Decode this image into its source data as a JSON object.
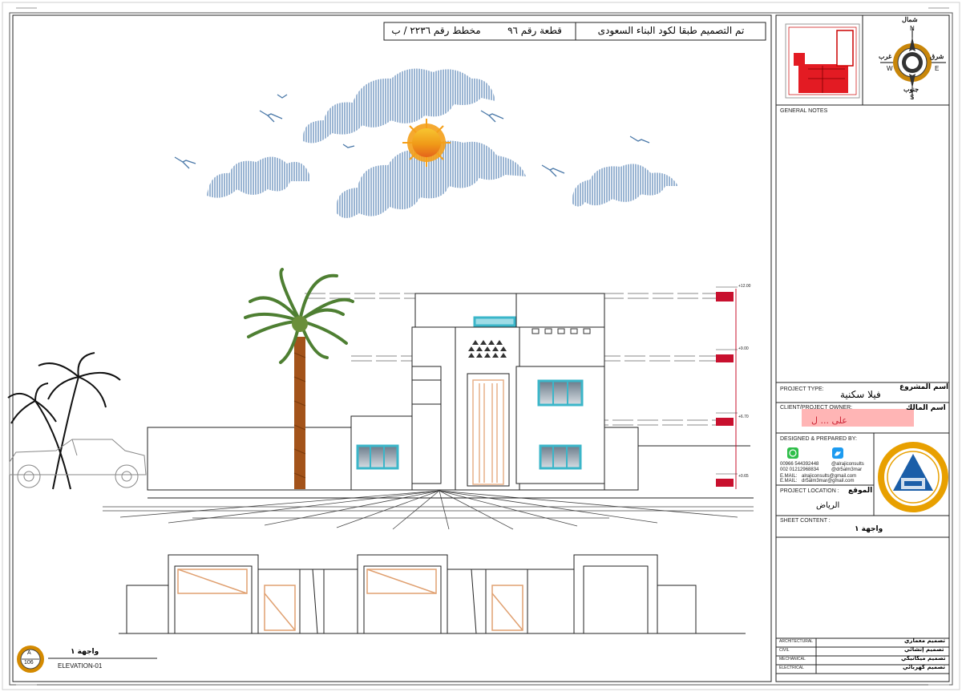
{
  "header_note": {
    "code_text": "تم التصميم طبقا لكود البناء السعودى",
    "plot_text": "قطعة رقم ٩٦",
    "plan_text": "مخطط رقم ٢٢٣٦ / ب"
  },
  "compass": {
    "n": "N",
    "s": "S",
    "e": "E",
    "w": "W",
    "north_ar": "شمال",
    "south_ar": "جنوب",
    "east_ar": "شرق",
    "west_ar": "غرب"
  },
  "title_block": {
    "general_notes": "GENERAL NOTES",
    "project_type_label": "PROJECT TYPE:",
    "project_type_ar_label": "اسم المشروع",
    "project_type_value": "فيلا سكنية",
    "client_label": "CLIENT/PROJECT OWNER:",
    "client_ar_label": "اسم المالك",
    "client_value": "على ... ل",
    "designed_label": "DESIGNED & PREPARED BY:",
    "contacts": [
      {
        "phone": "00966 544392448",
        "handle": "@alrajiconsults"
      },
      {
        "phone": "002 01212968834",
        "handle": "@dr5alm3mar"
      }
    ],
    "email1_label": "E.MAIL:",
    "email1": "alrajiconsults@gmail.com",
    "email2_label": "E.MAIL:",
    "email2": "dr5alm3mar@gmail.com",
    "location_label": "PROJECT LOCATION :",
    "location_ar_label": "الموقع",
    "location_value": "الرياض",
    "sheet_content_label": "SHEET CONTENT :",
    "sheet_content_value": "واجهة ١",
    "disciplines": [
      {
        "en": "ARCHITECTURAL",
        "ar": "تصميم معماري"
      },
      {
        "en": "CIVIL",
        "ar": "تصميم إنشائي"
      },
      {
        "en": "MECHANICAL",
        "ar": "تصميم ميكانيكي"
      },
      {
        "en": "ELECTRICAL",
        "ar": "تصميم كهربائي"
      }
    ]
  },
  "drawing": {
    "label_ar": "واجهة ١",
    "label_en": "ELEVATION-01",
    "badge_letter": "A",
    "badge_number": "106",
    "levels": [
      "+12.00",
      "+9.00",
      "+6.70",
      "+0.65"
    ]
  },
  "colors": {
    "cloud": "#7fa3c9",
    "sun": "#f2a21a",
    "window": "#3bb6c9",
    "door": "#e9b88e",
    "palm": "#5a8a3a",
    "red_mark": "#c8102e",
    "badge_gold": "#d48a00"
  }
}
